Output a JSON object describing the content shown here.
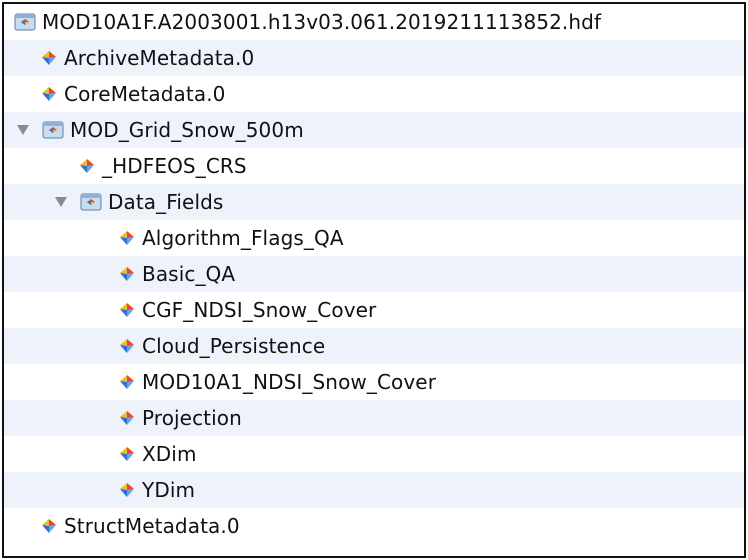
{
  "tree": {
    "root_file": "MOD10A1F.A2003001.h13v03.061.2019211113852.hdf",
    "archive_metadata": "ArchiveMetadata.0",
    "core_metadata": "CoreMetadata.0",
    "grid_group": "MOD_Grid_Snow_500m",
    "hdfeos_crs": "_HDFEOS_CRS",
    "data_fields_group": "Data_Fields",
    "fields": [
      "Algorithm_Flags_QA",
      "Basic_QA",
      "CGF_NDSI_Snow_Cover",
      "Cloud_Persistence",
      "MOD10A1_NDSI_Snow_Cover",
      "Projection",
      "XDim",
      "YDim"
    ],
    "struct_metadata": "StructMetadata.0"
  },
  "colors": {
    "alternate_row": "#eef3fb",
    "border": "#111111",
    "text": "#111111",
    "disclosure_triangle": "#8a8a8a"
  },
  "icons": {
    "file": "hdf-file-icon",
    "group": "group-folder-icon",
    "dataset": "dataset-icon",
    "expanded": "disclosure-expanded-icon"
  }
}
